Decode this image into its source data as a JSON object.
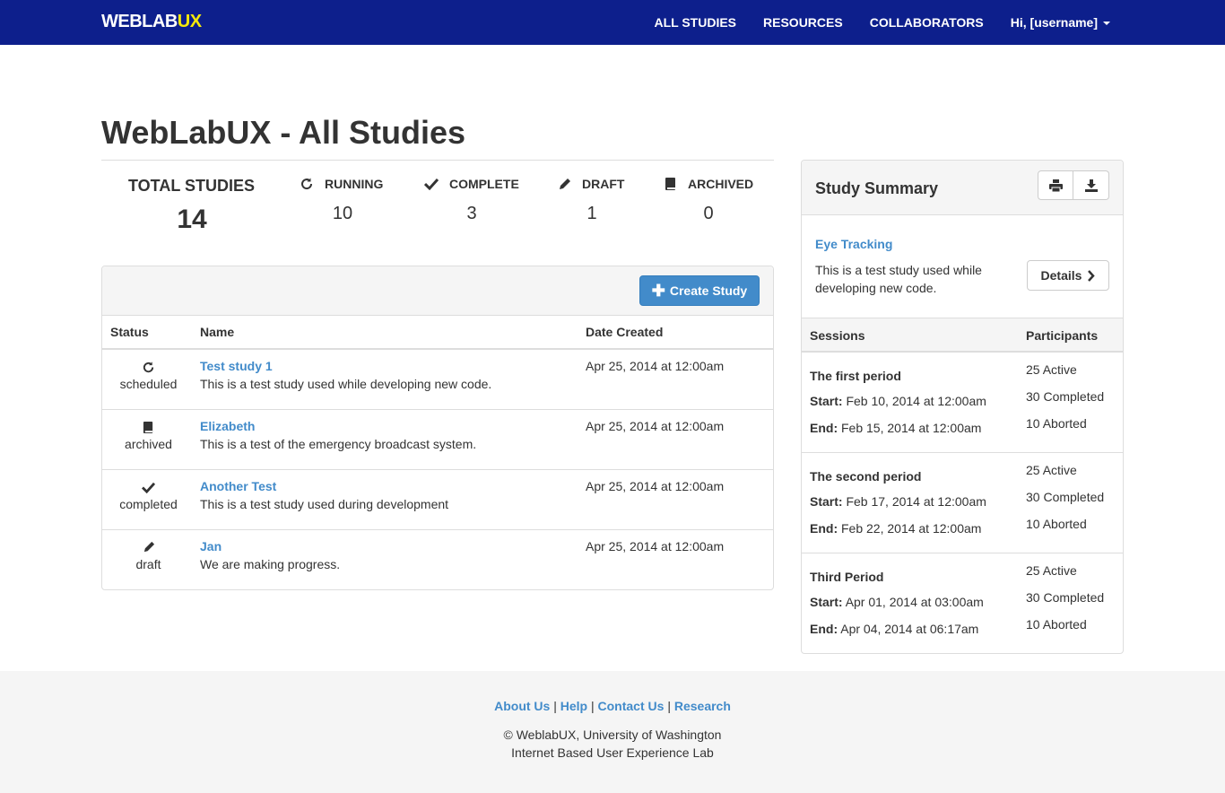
{
  "navbar": {
    "brand_main": "WEBLAB",
    "brand_accent": "UX",
    "links": [
      "ALL STUDIES",
      "RESOURCES",
      "COLLABORATORS"
    ],
    "user_menu": "Hi, [username]"
  },
  "page": {
    "title": "WebLabUX - All Studies"
  },
  "stats": {
    "total": {
      "label": "TOTAL STUDIES",
      "value": "14"
    },
    "running": {
      "label": "RUNNING",
      "value": "10"
    },
    "complete": {
      "label": "COMPLETE",
      "value": "3"
    },
    "draft": {
      "label": "DRAFT",
      "value": "1"
    },
    "archived": {
      "label": "ARCHIVED",
      "value": "0"
    }
  },
  "studies": {
    "create_label": "Create Study",
    "columns": [
      "Status",
      "Name",
      "Date Created"
    ],
    "rows": [
      {
        "status": "scheduled",
        "icon": "refresh-icon",
        "name": "Test study 1",
        "desc": "This is a test study used while developing new code.",
        "date": "Apr 25, 2014 at 12:00am"
      },
      {
        "status": "archived",
        "icon": "book-icon",
        "name": "Elizabeth",
        "desc": "This is a test of the emergency broadcast system.",
        "date": "Apr 25, 2014 at 12:00am"
      },
      {
        "status": "completed",
        "icon": "check-icon",
        "name": "Another Test",
        "desc": "This is a test study used during development",
        "date": "Apr 25, 2014 at 12:00am"
      },
      {
        "status": "draft",
        "icon": "pencil-icon",
        "name": "Jan",
        "desc": "We are making progress.",
        "date": "Apr 25, 2014 at 12:00am"
      }
    ]
  },
  "summary": {
    "title": "Study Summary",
    "study_name": "Eye Tracking",
    "study_desc": "This is a test study used while developing new code.",
    "details_label": "Details",
    "columns": [
      "Sessions",
      "Participants"
    ],
    "start_label": "Start:",
    "end_label": "End:",
    "sessions": [
      {
        "name": "The first period",
        "start": "Feb 10, 2014 at 12:00am",
        "end": "Feb 15, 2014 at 12:00am",
        "active": "25 Active",
        "completed": "30 Completed",
        "aborted": "10 Aborted"
      },
      {
        "name": "The second period",
        "start": "Feb 17, 2014 at 12:00am",
        "end": "Feb 22, 2014 at 12:00am",
        "active": "25 Active",
        "completed": "30 Completed",
        "aborted": "10 Aborted"
      },
      {
        "name": "Third Period",
        "start": "Apr 01, 2014 at 03:00am",
        "end": "Apr 04, 2014 at 06:17am",
        "active": "25 Active",
        "completed": "30 Completed",
        "aborted": "10 Aborted"
      }
    ]
  },
  "footer": {
    "links": [
      "About Us",
      "Help",
      "Contact Us",
      "Research"
    ],
    "separator": "|",
    "copyright": "© WeblabUX, University of Washington",
    "lab": "Internet Based User Experience Lab"
  },
  "colors": {
    "navbar": "#0d1f8c",
    "brand_accent": "#f5e90a",
    "link": "#428bca",
    "primary_button": "#428bca"
  }
}
